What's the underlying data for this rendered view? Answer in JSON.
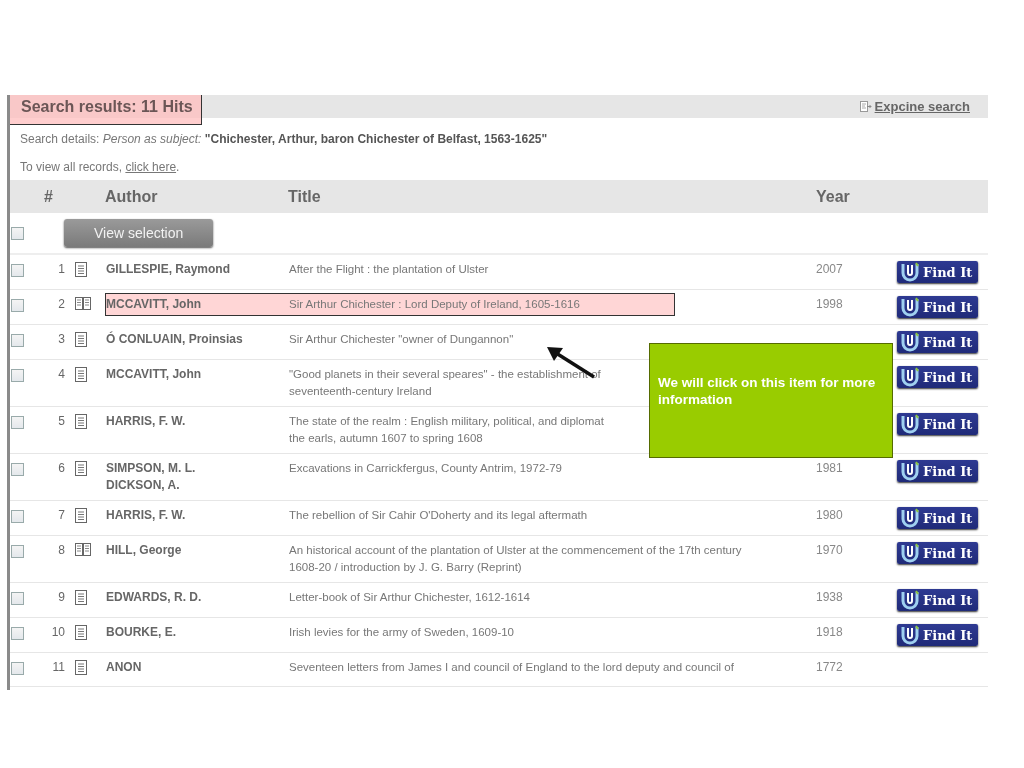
{
  "heading": {
    "text": "Search results: 11 Hits",
    "highlighted": true
  },
  "refine_link": "Expcine search",
  "details": {
    "label": "Search details:",
    "qualifier": "Person as subject:",
    "value": "\"Chichester, Arthur, baron Chichester of Belfast, 1563-1625\""
  },
  "view_all": {
    "text": "To view all records,",
    "link": "click here",
    "end": "."
  },
  "columns": [
    "#",
    "Author",
    "Title",
    "Year"
  ],
  "select_all": {
    "checked": false
  },
  "view_selection_button": "View selection",
  "rows": [
    {
      "checked": false,
      "number": "1",
      "kind": "document",
      "authors": [
        "GILLESPIE, Raymond"
      ],
      "title_lines": [
        "After the Flight : the plantation of Ulster"
      ],
      "year": "2007",
      "find_it": "Find It",
      "highlighted": false
    },
    {
      "checked": false,
      "number": "2",
      "kind": "book",
      "authors": [
        "MCCAVITT, John"
      ],
      "title_lines": [
        "Sir Arthur Chichester : Lord Deputy of Ireland, 1605-1616"
      ],
      "year": "1998",
      "find_it": "Find It",
      "highlighted": true
    },
    {
      "checked": false,
      "number": "3",
      "kind": "document",
      "authors": [
        "Ó CONLUAIN, Proinsias"
      ],
      "title_lines": [
        "Sir Arthur Chichester \"owner of Dungannon\""
      ],
      "find_it": "Find It",
      "highlighted": false
    },
    {
      "checked": false,
      "number": "4",
      "kind": "document",
      "authors": [
        "MCCAVITT, John"
      ],
      "title_lines": [
        "\"Good planets in their several speares\" - the establishment of",
        "seventeenth-century Ireland"
      ],
      "find_it": "Find It",
      "highlighted": false
    },
    {
      "checked": false,
      "number": "5",
      "kind": "document",
      "authors": [
        "HARRIS, F. W."
      ],
      "title_lines": [
        "The state of the realm : English military, political, and diplomat",
        "the earls, autumn 1607 to spring 1608"
      ],
      "find_it": "Find It",
      "highlighted": false
    },
    {
      "checked": false,
      "number": "6",
      "kind": "document",
      "authors": [
        "SIMPSON, M. L.",
        "DICKSON, A."
      ],
      "title_lines": [
        "Excavations in Carrickfergus, County Antrim, 1972-79"
      ],
      "year": "1981",
      "find_it": "Find It",
      "highlighted": false
    },
    {
      "checked": false,
      "number": "7",
      "kind": "document",
      "authors": [
        "HARRIS, F. W."
      ],
      "title_lines": [
        "The rebellion of Sir Cahir O'Doherty and its legal aftermath"
      ],
      "year": "1980",
      "find_it": "Find It",
      "highlighted": false
    },
    {
      "checked": false,
      "number": "8",
      "kind": "book",
      "authors": [
        "HILL, George"
      ],
      "title_lines": [
        "An historical account of the plantation of Ulster at the commencement of the 17th century",
        "1608-20 / introduction by J. G. Barry (Reprint)"
      ],
      "year": "1970",
      "find_it": "Find It",
      "highlighted": false
    },
    {
      "checked": false,
      "number": "9",
      "kind": "document",
      "authors": [
        "EDWARDS, R. D."
      ],
      "title_lines": [
        "Letter-book of Sir Arthur Chichester, 1612-1614"
      ],
      "year": "1938",
      "find_it": "Find It",
      "highlighted": false
    },
    {
      "checked": false,
      "number": "10",
      "kind": "document",
      "authors": [
        "BOURKE, E."
      ],
      "title_lines": [
        "Irish levies for the army of Sweden, 1609-10"
      ],
      "year": "1918",
      "find_it": "Find It",
      "highlighted": false
    },
    {
      "checked": false,
      "number": "11",
      "kind": "document",
      "authors": [
        "ANON"
      ],
      "title_lines": [
        "Seventeen letters from James I and council of England to the lord deputy and council of"
      ],
      "year": "1772",
      "highlighted": false
    }
  ],
  "callout": {
    "text": "We will click on this item for more information"
  }
}
